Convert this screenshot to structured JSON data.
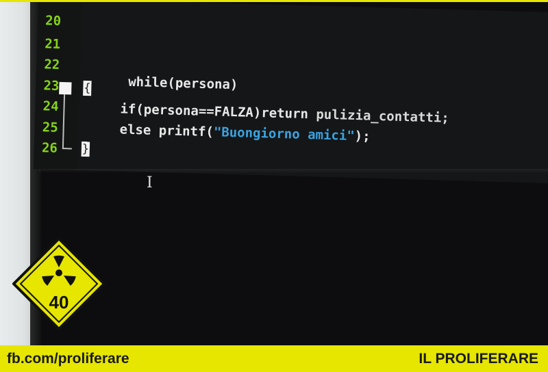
{
  "code_view": {
    "line_numbers": [
      "20",
      "21",
      "22",
      "23",
      "24",
      "25",
      "26"
    ],
    "lines": {
      "l22": "while(persona)",
      "l23_brace": "{",
      "l24_a": "if(persona==FALZA)",
      "l24_b": "return ",
      "l24_c": "pulizia_contatti;",
      "l25_a": "else printf(",
      "l25_str": "\"Buongiorno amici\"",
      "l25_b": ");",
      "l26_brace": "}"
    }
  },
  "badge": {
    "number": "40",
    "icon": "radiation-icon",
    "color": "#e6e600"
  },
  "footer": {
    "left_text": "fb.com/proliferare",
    "right_text": "IL PROLIFERARE",
    "color": "#e6e600"
  }
}
